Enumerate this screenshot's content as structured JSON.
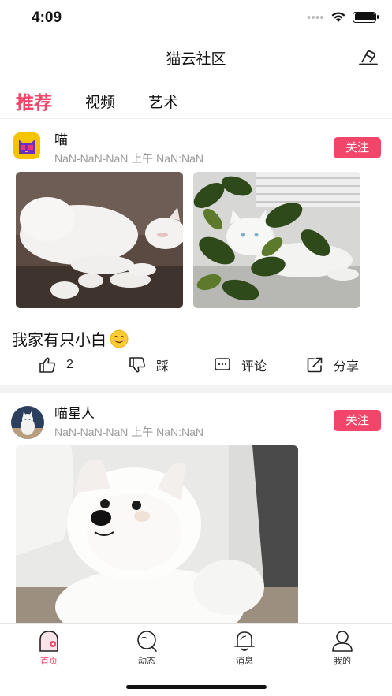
{
  "status_bar": {
    "time": "4:09"
  },
  "nav": {
    "title": "猫云社区"
  },
  "tabs": [
    {
      "label": "推荐",
      "active": true
    },
    {
      "label": "视频",
      "active": false
    },
    {
      "label": "艺术",
      "active": false
    }
  ],
  "posts": [
    {
      "username": "喵",
      "time": "NaN-NaN-NaN 上午 NaN:NaN",
      "follow_label": "关注",
      "caption": "我家有只小白",
      "images": [
        "white-cat-lying-on-couch",
        "white-cat-behind-plant"
      ],
      "actions": {
        "like_count": "2",
        "dislike_label": "踩",
        "comment_label": "评论",
        "share_label": "分享"
      }
    },
    {
      "username": "喵星人",
      "time": "NaN-NaN-NaN 上午 NaN:NaN",
      "follow_label": "关注",
      "images": [
        "white-pomeranian-dog"
      ]
    }
  ],
  "tab_bar": [
    {
      "label": "首页",
      "icon": "home-icon",
      "active": true
    },
    {
      "label": "动态",
      "icon": "chat-bubble-icon",
      "active": false
    },
    {
      "label": "消息",
      "icon": "bell-icon",
      "active": false
    },
    {
      "label": "我的",
      "icon": "user-icon",
      "active": false
    }
  ],
  "colors": {
    "accent": "#f2456a",
    "text": "#111111",
    "muted": "#9a9a9a",
    "separator": "#f2f2f2"
  }
}
